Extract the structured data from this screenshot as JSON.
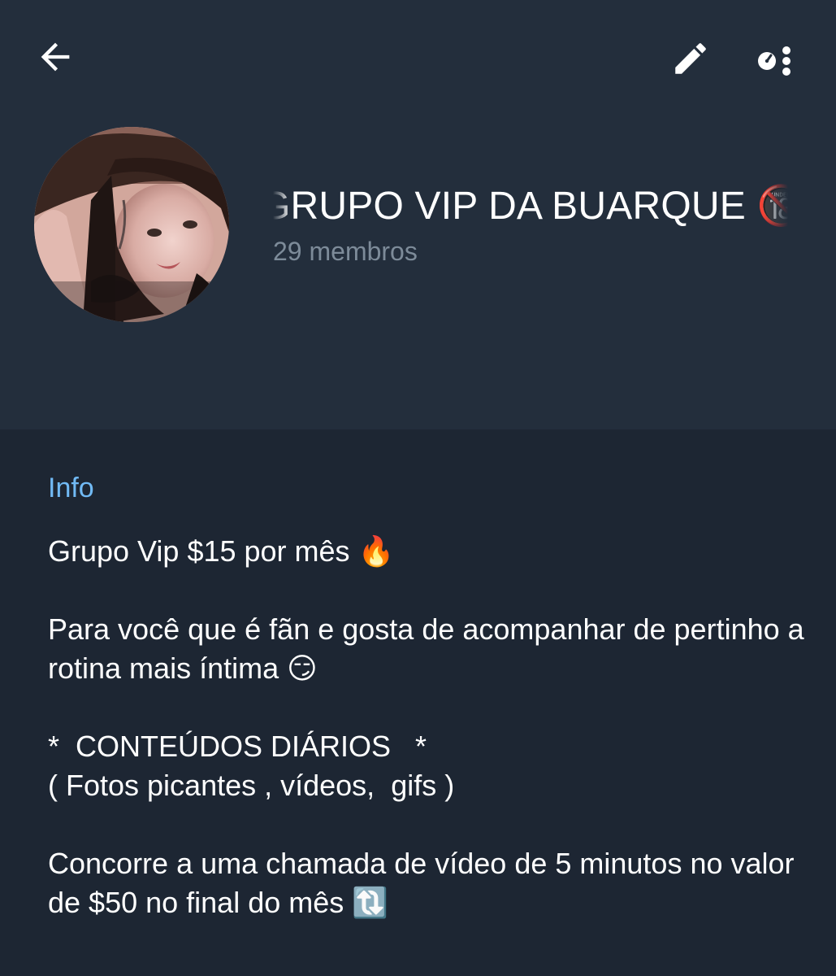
{
  "header": {
    "back_icon": "arrow-left-icon",
    "edit_icon": "pencil-icon",
    "more_icon": "more-vertical-icon",
    "title": "GRUPO VIP DA BUARQUE 🔞😱    GRUPO VIP DA BUARQUE",
    "members": "29 membros"
  },
  "info": {
    "label": "Info",
    "description": "Grupo Vip $15 por mês 🔥\n\nPara você que é fãn e gosta de acompanhar de pertinho a rotina mais íntima 😏\n\n*  CONTEÚDOS DIÁRIOS   *\n( Fotos picantes , vídeos,  gifs )\n\nConcorre a uma chamada de vídeo de 5 minutos no valor de $50 no final do mês 🔃"
  },
  "colors": {
    "header_bg": "#232e3c",
    "body_bg": "#1d2633",
    "accent": "#71baf5",
    "muted_text": "#7d8b99"
  }
}
